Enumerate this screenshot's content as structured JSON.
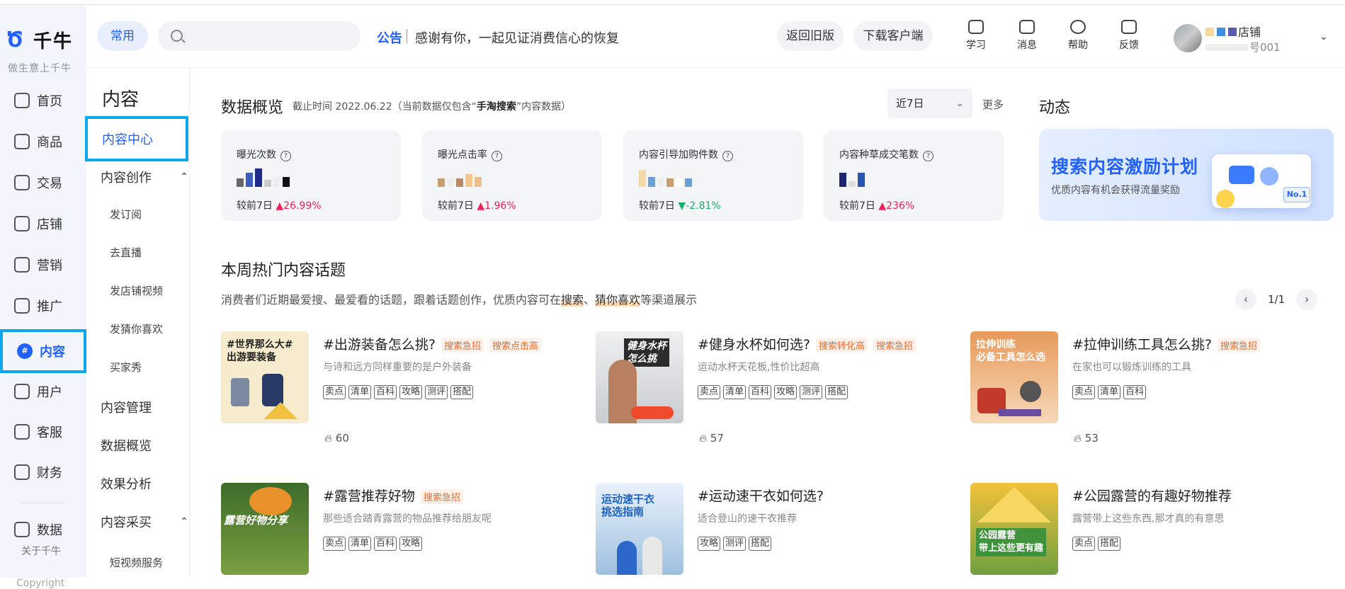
{
  "brand": {
    "logo": "千牛",
    "slogan": "做生意上千牛"
  },
  "nav": {
    "items": [
      {
        "label": "首页",
        "icon": "home-icon"
      },
      {
        "label": "商品",
        "icon": "goods-icon"
      },
      {
        "label": "交易",
        "icon": "trade-icon"
      },
      {
        "label": "店铺",
        "icon": "shop-icon"
      },
      {
        "label": "营销",
        "icon": "marketing-icon"
      },
      {
        "label": "推广",
        "icon": "promotion-icon"
      },
      {
        "label": "内容",
        "icon": "content-icon"
      },
      {
        "label": "用户",
        "icon": "user-icon"
      },
      {
        "label": "客服",
        "icon": "service-icon"
      },
      {
        "label": "财务",
        "icon": "finance-icon"
      },
      {
        "label": "数据",
        "icon": "data-icon"
      }
    ],
    "active": "内容",
    "about": "关于千牛",
    "copyright": "Copyright"
  },
  "subnav": {
    "title": "内容",
    "items": {
      "center": "内容中心",
      "create": "内容创作",
      "subscribe": "发订阅",
      "live": "去直播",
      "shop_video": "发店铺视频",
      "guess": "发猜你喜欢",
      "buyer_show": "买家秀",
      "manage": "内容管理",
      "overview": "数据概览",
      "analysis": "效果分析",
      "purchase": "内容采买",
      "short_video": "短视频服务"
    }
  },
  "header": {
    "common_chip": "常用",
    "search_placeholder": "",
    "notice_tag": "公告",
    "notice_text": "感谢有你，一起见证消费信心的恢复",
    "btn_old": "返回旧版",
    "btn_download": "下载客户端",
    "tools": [
      {
        "label": "学习",
        "icon": "study-icon"
      },
      {
        "label": "消息",
        "icon": "message-icon"
      },
      {
        "label": "帮助",
        "icon": "help-icon"
      },
      {
        "label": "反馈",
        "icon": "feedback-icon"
      }
    ],
    "shop_name": "店铺",
    "shop_sub": "号001"
  },
  "overview": {
    "title": "数据概览",
    "note_prefix": "截止时间 2022.06.22（当前数据仅包含“",
    "note_bold": "手淘搜索",
    "note_suffix": "”内容数据）",
    "range": "近7日",
    "more": "更多",
    "cards": [
      {
        "label": "曝光次数",
        "cmp_label": "较前7日",
        "arrow": "▲",
        "change": "26.99%",
        "dir": "up"
      },
      {
        "label": "曝光点击率",
        "cmp_label": "较前7日",
        "arrow": "▲",
        "change": "1.96%",
        "dir": "up"
      },
      {
        "label": "内容引导加购件数",
        "cmp_label": "较前7日",
        "arrow": "▼",
        "change": "-2.81%",
        "dir": "down"
      },
      {
        "label": "内容种草成交笔数",
        "cmp_label": "较前7日",
        "arrow": "▲",
        "change": "236%",
        "dir": "up"
      }
    ]
  },
  "dynamic": {
    "title": "动态",
    "banner_title": "搜索内容激励计划",
    "banner_sub": "优质内容有机会获得流量奖励",
    "badge": "No.1"
  },
  "topics": {
    "title": "本周热门内容话题",
    "desc_a": "消费者们近期最爱搜、最爱看的话题，跟着话题创作，优质内容可在",
    "desc_hl1": "搜索",
    "desc_sep": "、",
    "desc_hl2": "猜你喜欢",
    "desc_b": "等渠道展示",
    "pager": "1/1",
    "items": [
      {
        "title": "#出游装备怎么挑?",
        "tags": [
          "搜索急招",
          "搜索点击高"
        ],
        "desc": "与诗和远方同样重要的是户外装备",
        "chips": [
          "卖点",
          "清单",
          "百科",
          "攻略",
          "测评",
          "搭配"
        ],
        "heat": "60",
        "cover": "#世界那么大#\n出游要装备"
      },
      {
        "title": "#健身水杯如何选?",
        "tags": [
          "搜索转化高",
          "搜索急招"
        ],
        "desc": "运动水杯天花板,性价比超高",
        "chips": [
          "卖点",
          "清单",
          "百科",
          "攻略",
          "测评",
          "搭配"
        ],
        "heat": "57",
        "cover": "健身水杯\n怎么挑"
      },
      {
        "title": "#拉伸训练工具怎么挑?",
        "tags": [
          "搜索急招"
        ],
        "desc": "在家也可以锻炼训练的工具",
        "chips": [
          "卖点",
          "清单",
          "百科"
        ],
        "heat": "53",
        "cover": "拉伸训练\n必备工具怎么选"
      },
      {
        "title": "#露营推荐好物",
        "tags": [
          "搜索急招"
        ],
        "desc": "那些适合踏青露营的物品推荐给朋友呢",
        "chips": [
          "卖点",
          "清单",
          "百科",
          "攻略"
        ],
        "heat": "",
        "cover": "露营好物分享"
      },
      {
        "title": "#运动速干衣如何选?",
        "tags": [],
        "desc": "适合登山的速干衣推荐",
        "chips": [
          "攻略",
          "测评",
          "搭配"
        ],
        "heat": "",
        "cover": "运动速干衣\n挑选指南"
      },
      {
        "title": "#公园露营的有趣好物推荐",
        "tags": [],
        "desc": "露营带上这些东西,那才真的有意思",
        "chips": [
          "卖点",
          "搭配"
        ],
        "heat": "",
        "cover": "公园露营\n带上这些更有趣"
      }
    ]
  },
  "colors": {
    "accent": "#2261ff",
    "up": "#f0205a",
    "down": "#17b06b",
    "tag": "#f06a2e"
  }
}
